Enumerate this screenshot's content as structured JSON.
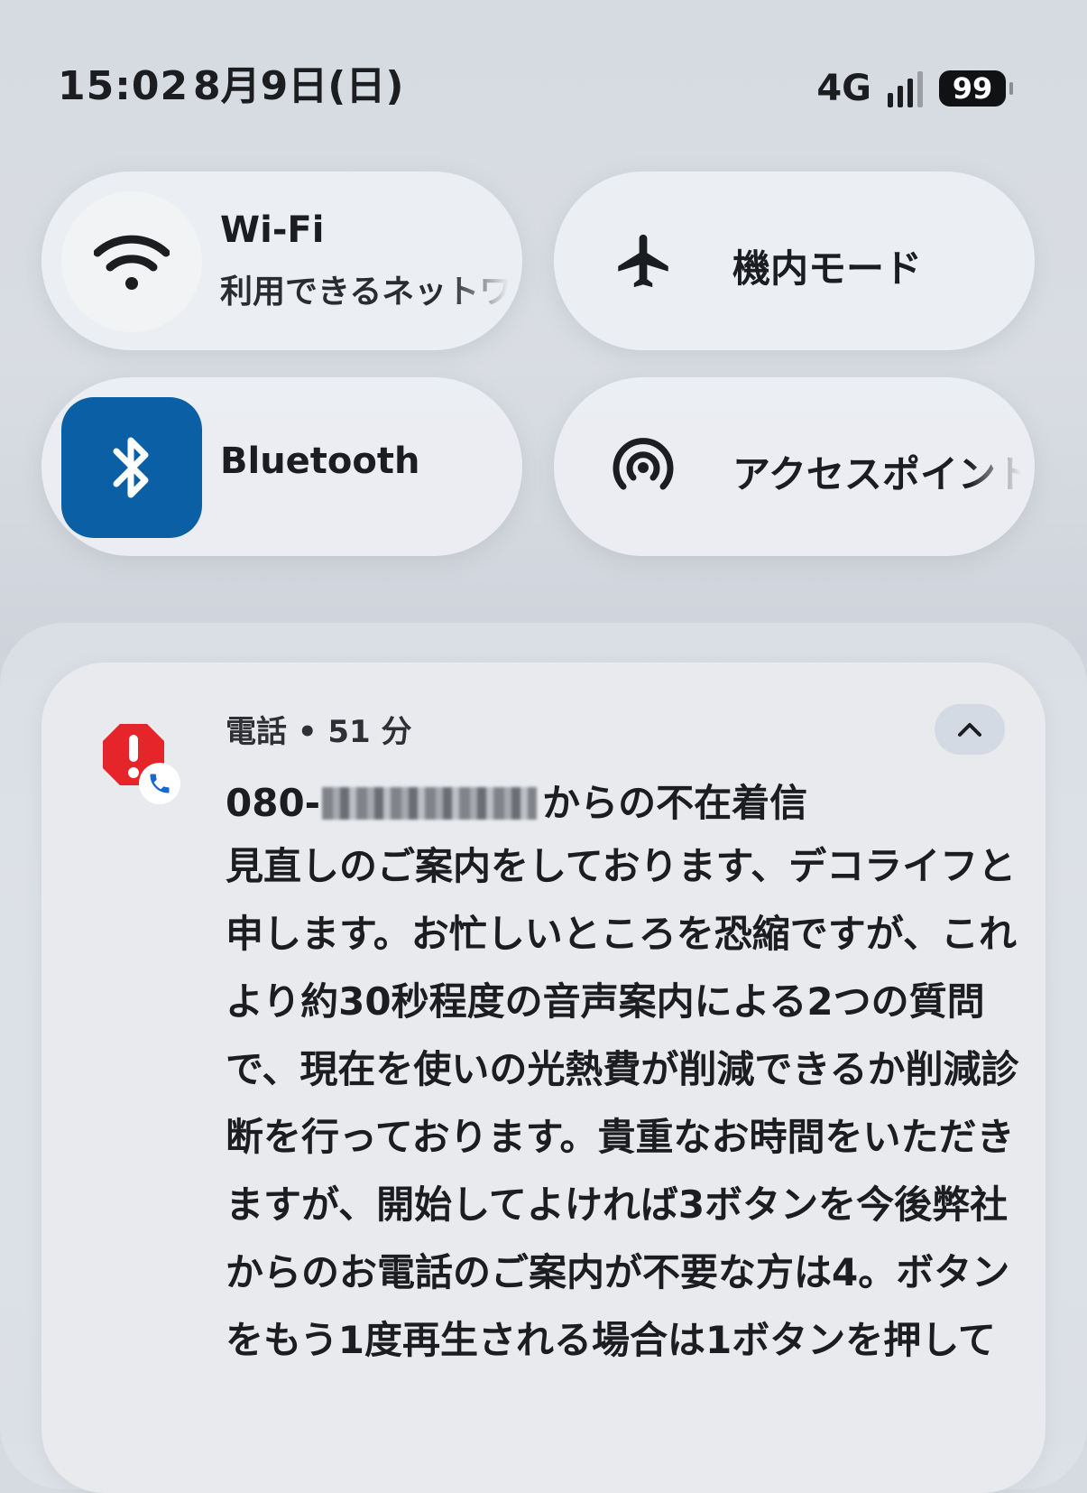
{
  "status_bar": {
    "time": "15:02",
    "date": "8月9日(日)",
    "network": "4G",
    "signal_icon": "signal-bars-icon",
    "battery_level": "99"
  },
  "quick_settings": {
    "wifi": {
      "label": "Wi-Fi",
      "status": "利用できるネットワーク",
      "icon": "wifi-icon",
      "active": false
    },
    "airplane": {
      "label": "機内モード",
      "icon": "airplane-icon",
      "active": false
    },
    "bluetooth": {
      "label": "Bluetooth",
      "icon": "bluetooth-icon",
      "active": true,
      "active_color": "#0b5fa5"
    },
    "hotspot": {
      "label": "アクセスポイント",
      "icon": "hotspot-icon",
      "active": false
    }
  },
  "notification": {
    "app_icon": "missed-call-alert-icon",
    "badge_icon": "phone-icon",
    "header": "電話 • 51 分",
    "title_prefix": "080-",
    "title_suffix": "からの不在着信",
    "body": "見直しのご案内をしております、デコライフと申します。お忙しいところを恐縮ですが、これより約30秒程度の音声案内による2つの質問で、現在を使いの光熱費が削減できるか削減診断を行っております。貴重なお時間をいただきますが、開始してよければ3ボタンを今後弊社からのお電話のご案内が不要な方は4。ボタンをもう1度再生される場合は1ボタンを押して",
    "collapse_icon": "chevron-up-icon",
    "alert_color": "#e5252a"
  }
}
